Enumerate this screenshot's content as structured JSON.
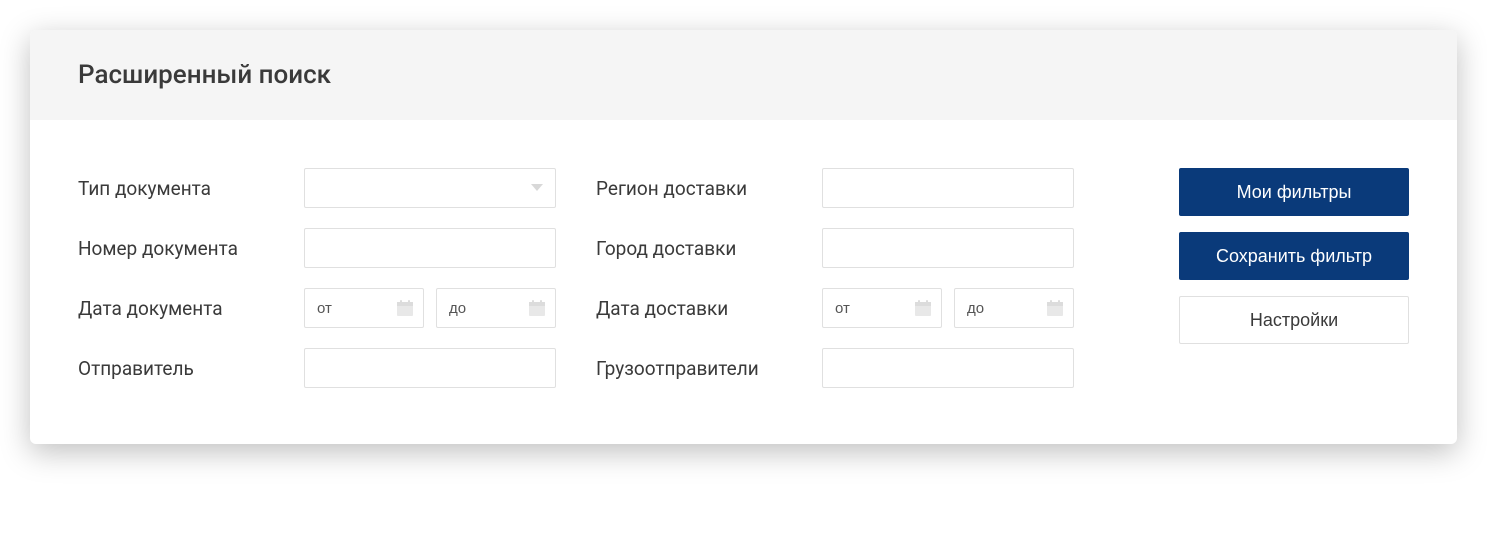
{
  "header": {
    "title": "Расширенный поиск"
  },
  "leftCol": {
    "doc_type": {
      "label": "Тип документа",
      "value": ""
    },
    "doc_number": {
      "label": "Номер документа",
      "value": ""
    },
    "doc_date": {
      "label": "Дата документа",
      "from_placeholder": "от",
      "to_placeholder": "до"
    },
    "sender": {
      "label": "Отправитель",
      "value": ""
    }
  },
  "rightCol": {
    "delivery_region": {
      "label": "Регион доставки",
      "value": ""
    },
    "delivery_city": {
      "label": "Город доставки",
      "value": ""
    },
    "delivery_date": {
      "label": "Дата доставки",
      "from_placeholder": "от",
      "to_placeholder": "до"
    },
    "shippers": {
      "label": "Грузоотправители",
      "value": ""
    }
  },
  "actions": {
    "my_filters": "Мои фильтры",
    "save_filter": "Сохранить фильтр",
    "settings": "Настройки"
  }
}
